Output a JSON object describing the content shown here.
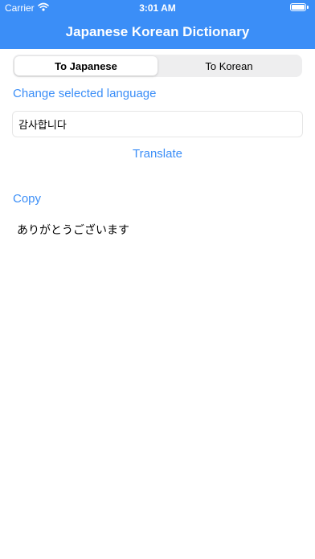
{
  "status_bar": {
    "carrier": "Carrier",
    "time": "3:01 AM",
    "wifi_icon": "wifi-icon",
    "battery_icon": "battery-icon"
  },
  "nav": {
    "title": "Japanese Korean Dictionary"
  },
  "segments": {
    "to_japanese": "To Japanese",
    "to_korean": "To Korean",
    "selected": "To Japanese"
  },
  "change_language_label": "Change selected language",
  "input": {
    "value": "감사합니다"
  },
  "translate_label": "Translate",
  "copy_label": "Copy",
  "result": {
    "text": "ありがとうございます"
  },
  "colors": {
    "accent": "#3b8ef7",
    "header_background": "#3b8ef7",
    "segment_background": "#eeeeef"
  }
}
